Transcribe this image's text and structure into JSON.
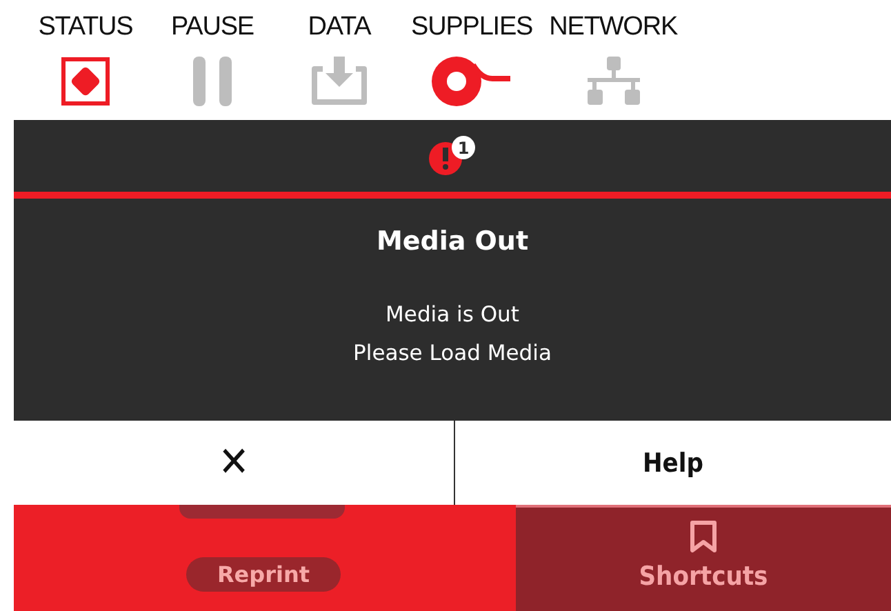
{
  "status_bar": [
    {
      "label": "STATUS",
      "active": true
    },
    {
      "label": "PAUSE",
      "active": false
    },
    {
      "label": "DATA",
      "active": false
    },
    {
      "label": "SUPPLIES",
      "active": true
    },
    {
      "label": "NETWORK",
      "active": false
    }
  ],
  "alert": {
    "count": "1",
    "title": "Media Out",
    "message_lines": [
      "Media is Out",
      "Please Load Media"
    ]
  },
  "buttons": [
    {
      "kind": "close",
      "label": "✕"
    },
    {
      "kind": "text",
      "label": "Help"
    }
  ],
  "home": {
    "reprint": "Reprint",
    "shortcuts": "Shortcuts"
  }
}
